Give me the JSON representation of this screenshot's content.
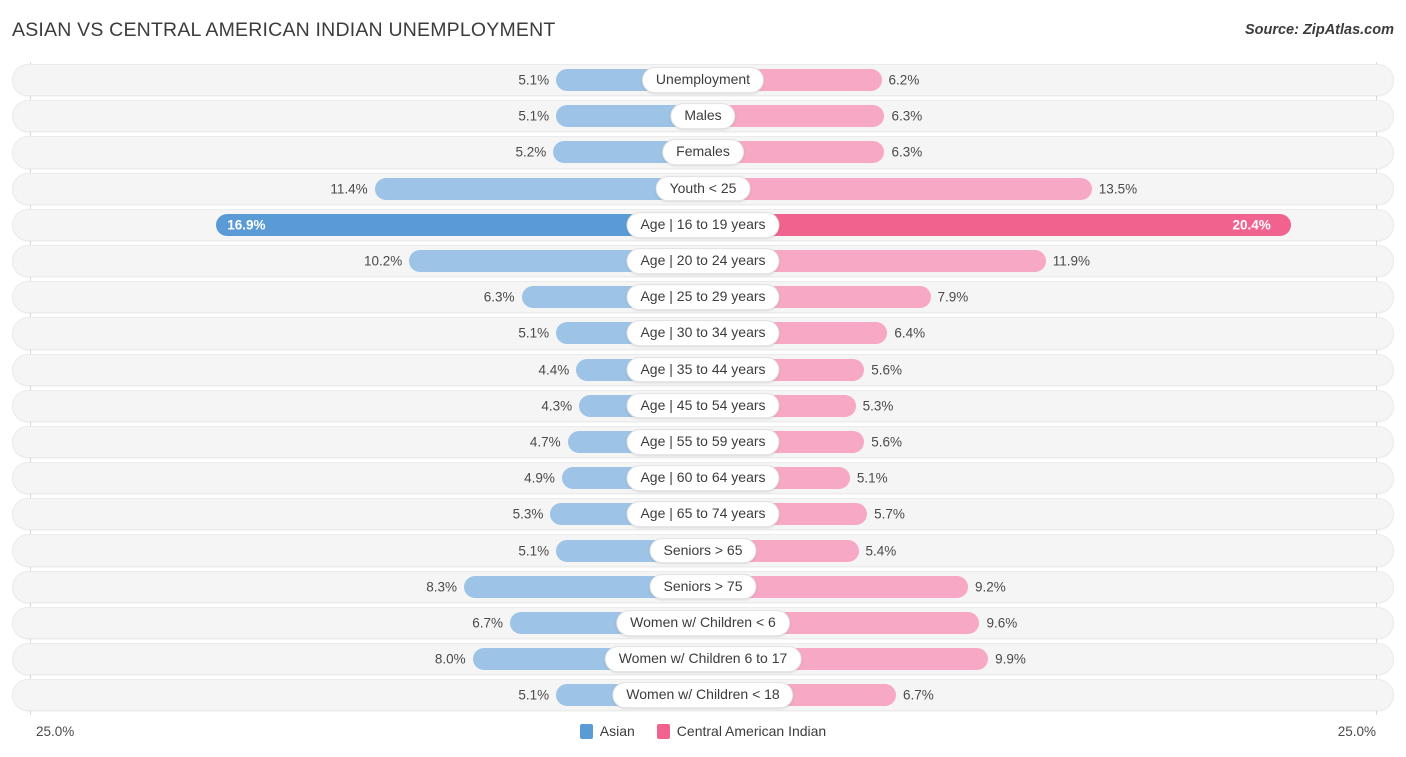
{
  "header": {
    "title": "ASIAN VS CENTRAL AMERICAN INDIAN UNEMPLOYMENT",
    "source": "Source: ZipAtlas.com"
  },
  "footer": {
    "axis_left": "25.0%",
    "axis_right": "25.0%"
  },
  "legend": [
    {
      "label": "Asian",
      "color": "#5b9bd5"
    },
    {
      "label": "Central American Indian",
      "color": "#f2628f"
    }
  ],
  "colors": {
    "left_bar": "#9dc3e6",
    "left_bar_max": "#5b9bd5",
    "right_bar": "#f7a8c4",
    "right_bar_max": "#f2628f",
    "track": "#f5f5f5",
    "track_border": "#ebebeb",
    "axis_line": "#d8d8d8",
    "text": "#3c3c3c"
  },
  "chart_data": {
    "type": "bar",
    "title": "ASIAN VS CENTRAL AMERICAN INDIAN UNEMPLOYMENT",
    "subtitle": "",
    "orientation": "horizontal-diverging",
    "xlabel": "",
    "ylabel": "",
    "xlim": [
      0,
      25
    ],
    "axis_max_label": "25.0%",
    "grid": false,
    "legend_position": "bottom-center",
    "categories": [
      "Unemployment",
      "Males",
      "Females",
      "Youth < 25",
      "Age | 16 to 19 years",
      "Age | 20 to 24 years",
      "Age | 25 to 29 years",
      "Age | 30 to 34 years",
      "Age | 35 to 44 years",
      "Age | 45 to 54 years",
      "Age | 55 to 59 years",
      "Age | 60 to 64 years",
      "Age | 65 to 74 years",
      "Seniors > 65",
      "Seniors > 75",
      "Women w/ Children < 6",
      "Women w/ Children 6 to 17",
      "Women w/ Children < 18"
    ],
    "series": [
      {
        "name": "Asian",
        "side": "left",
        "color": "#9dc3e6",
        "values": [
          5.1,
          5.1,
          5.2,
          11.4,
          16.9,
          10.2,
          6.3,
          5.1,
          4.4,
          4.3,
          4.7,
          4.9,
          5.3,
          5.1,
          8.3,
          6.7,
          8.0,
          5.1
        ],
        "labels": [
          "5.1%",
          "5.1%",
          "5.2%",
          "11.4%",
          "16.9%",
          "10.2%",
          "6.3%",
          "5.1%",
          "4.4%",
          "4.3%",
          "4.7%",
          "4.9%",
          "5.3%",
          "5.1%",
          "8.3%",
          "6.7%",
          "8.0%",
          "5.1%"
        ]
      },
      {
        "name": "Central American Indian",
        "side": "right",
        "color": "#f7a8c4",
        "values": [
          6.2,
          6.3,
          6.3,
          13.5,
          20.4,
          11.9,
          7.9,
          6.4,
          5.6,
          5.3,
          5.6,
          5.1,
          5.7,
          5.4,
          9.2,
          9.6,
          9.9,
          6.7
        ],
        "labels": [
          "6.2%",
          "6.3%",
          "6.3%",
          "13.5%",
          "20.4%",
          "11.9%",
          "7.9%",
          "6.4%",
          "5.6%",
          "5.3%",
          "5.6%",
          "5.1%",
          "5.7%",
          "5.4%",
          "9.2%",
          "9.6%",
          "9.9%",
          "6.7%"
        ]
      }
    ],
    "rows": [
      {
        "label": "Unemployment",
        "left": 5.1,
        "left_label": "5.1%",
        "right": 6.2,
        "right_label": "6.2%",
        "highlight": false
      },
      {
        "label": "Males",
        "left": 5.1,
        "left_label": "5.1%",
        "right": 6.3,
        "right_label": "6.3%",
        "highlight": false
      },
      {
        "label": "Females",
        "left": 5.2,
        "left_label": "5.2%",
        "right": 6.3,
        "right_label": "6.3%",
        "highlight": false
      },
      {
        "label": "Youth < 25",
        "left": 11.4,
        "left_label": "11.4%",
        "right": 13.5,
        "right_label": "13.5%",
        "highlight": false
      },
      {
        "label": "Age | 16 to 19 years",
        "left": 16.9,
        "left_label": "16.9%",
        "right": 20.4,
        "right_label": "20.4%",
        "highlight": true
      },
      {
        "label": "Age | 20 to 24 years",
        "left": 10.2,
        "left_label": "10.2%",
        "right": 11.9,
        "right_label": "11.9%",
        "highlight": false
      },
      {
        "label": "Age | 25 to 29 years",
        "left": 6.3,
        "left_label": "6.3%",
        "right": 7.9,
        "right_label": "7.9%",
        "highlight": false
      },
      {
        "label": "Age | 30 to 34 years",
        "left": 5.1,
        "left_label": "5.1%",
        "right": 6.4,
        "right_label": "6.4%",
        "highlight": false
      },
      {
        "label": "Age | 35 to 44 years",
        "left": 4.4,
        "left_label": "4.4%",
        "right": 5.6,
        "right_label": "5.6%",
        "highlight": false
      },
      {
        "label": "Age | 45 to 54 years",
        "left": 4.3,
        "left_label": "4.3%",
        "right": 5.3,
        "right_label": "5.3%",
        "highlight": false
      },
      {
        "label": "Age | 55 to 59 years",
        "left": 4.7,
        "left_label": "4.7%",
        "right": 5.6,
        "right_label": "5.6%",
        "highlight": false
      },
      {
        "label": "Age | 60 to 64 years",
        "left": 4.9,
        "left_label": "4.9%",
        "right": 5.1,
        "right_label": "5.1%",
        "highlight": false
      },
      {
        "label": "Age | 65 to 74 years",
        "left": 5.3,
        "left_label": "5.3%",
        "right": 5.7,
        "right_label": "5.7%",
        "highlight": false
      },
      {
        "label": "Seniors > 65",
        "left": 5.1,
        "left_label": "5.1%",
        "right": 5.4,
        "right_label": "5.4%",
        "highlight": false
      },
      {
        "label": "Seniors > 75",
        "left": 8.3,
        "left_label": "8.3%",
        "right": 9.2,
        "right_label": "9.2%",
        "highlight": false
      },
      {
        "label": "Women w/ Children < 6",
        "left": 6.7,
        "left_label": "6.7%",
        "right": 9.6,
        "right_label": "9.6%",
        "highlight": false
      },
      {
        "label": "Women w/ Children 6 to 17",
        "left": 8.0,
        "left_label": "8.0%",
        "right": 9.9,
        "right_label": "9.9%",
        "highlight": false
      },
      {
        "label": "Women w/ Children < 18",
        "left": 5.1,
        "left_label": "5.1%",
        "right": 6.7,
        "right_label": "6.7%",
        "highlight": false
      }
    ]
  }
}
